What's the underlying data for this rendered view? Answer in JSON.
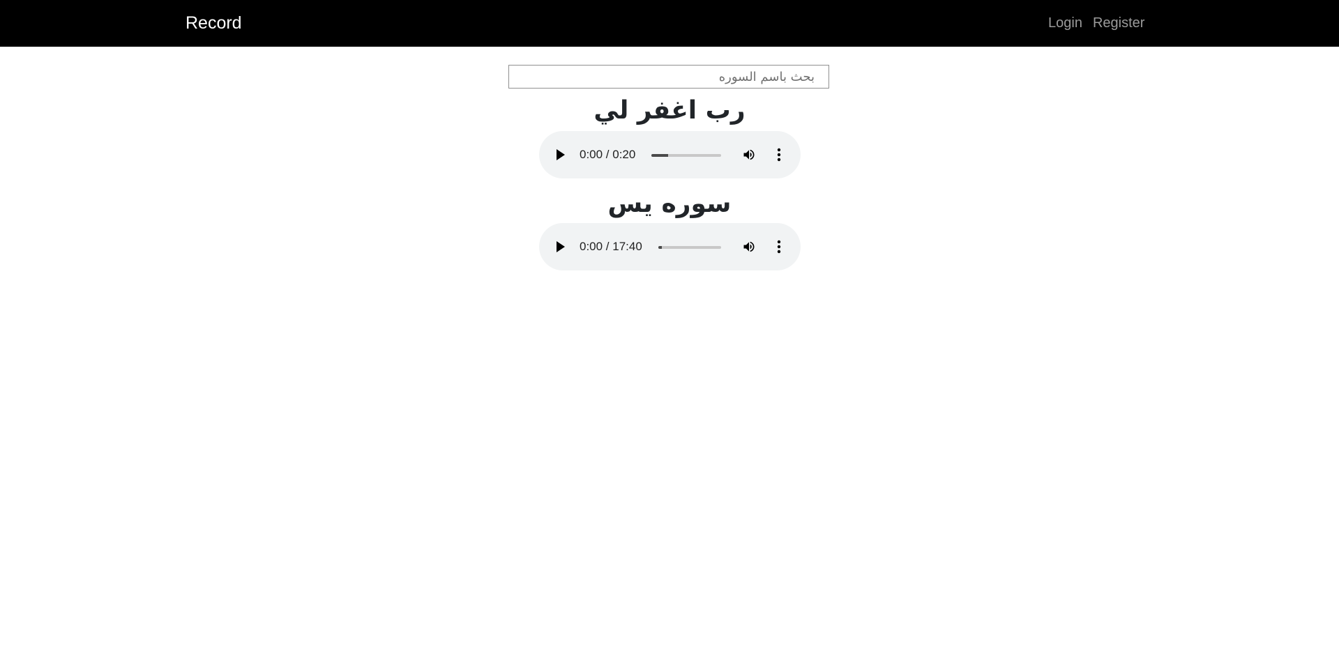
{
  "navbar": {
    "brand": "Record",
    "links": [
      "Login",
      "Register"
    ]
  },
  "search": {
    "placeholder": "بحث باسم السوره"
  },
  "recordings": [
    {
      "title": "رب اغفر لي",
      "time": "0:00 / 0:20",
      "buffered_fraction": 0.24
    },
    {
      "title": "سوره يس",
      "time": "0:00 / 17:40",
      "buffered_fraction": 0.05
    }
  ],
  "icons": {
    "play": "play-icon",
    "volume": "volume-icon",
    "more": "more-vert-icon"
  },
  "colors": {
    "navbar_bg": "#000000",
    "nav_link": "#9b9b9b",
    "title_text": "#212529",
    "player_bg": "#f1f3f4"
  }
}
